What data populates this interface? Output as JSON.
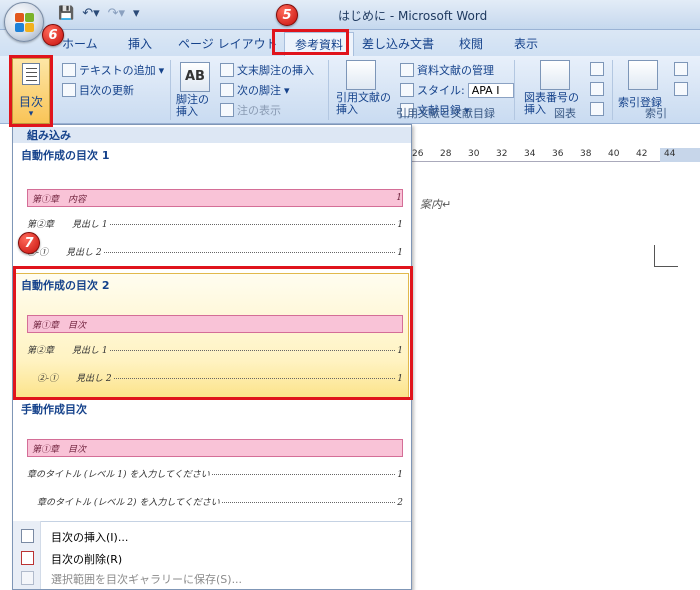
{
  "window": {
    "title": "はじめに - Microsoft Word"
  },
  "quick_access": {
    "save_icon": "save-icon",
    "undo_icon": "undo-icon",
    "redo_icon": "redo-icon"
  },
  "tabs": [
    {
      "label": "ホーム",
      "selected": false
    },
    {
      "label": "挿入",
      "selected": false
    },
    {
      "label": "ページ レイアウト",
      "selected": false
    },
    {
      "label": "参考資料",
      "selected": true
    },
    {
      "label": "差し込み文書",
      "selected": false
    },
    {
      "label": "校閲",
      "selected": false
    },
    {
      "label": "表示",
      "selected": false
    }
  ],
  "ribbon": {
    "toc_group": {
      "toc_button": "目次",
      "add_text": "テキストの追加",
      "update_toc": "目次の更新"
    },
    "footnote_group": {
      "insert_footnote": "脚注の\n挿入",
      "insert_endnote": "文末脚注の挿入",
      "next_footnote": "次の脚注",
      "show_notes": "注の表示"
    },
    "citation_group": {
      "insert_citation": "引用文献の\n挿入",
      "manage_sources": "資料文献の管理",
      "style_label": "スタイル:",
      "style_value": "APA I",
      "bibliography": "文献目録",
      "group_label": "引用文献と文献目録"
    },
    "caption_group": {
      "insert_caption": "図表番号の\n挿入",
      "group_label": "図表"
    },
    "index_group": {
      "mark_entry": "索引登録",
      "group_label": "索引"
    }
  },
  "ruler": {
    "ticks": [
      "26",
      "28",
      "30",
      "32",
      "34",
      "36",
      "38",
      "40",
      "42",
      "44"
    ]
  },
  "document": {
    "visible_text": "案内↵"
  },
  "toc_gallery": {
    "header": "組み込み",
    "entries": [
      {
        "title": "自動作成の目次 1",
        "lines": [
          {
            "text": "第①章　内容",
            "page": "1",
            "highlight": true
          },
          {
            "text": "第②章　　見出し 1",
            "page": "1"
          },
          {
            "text": "②-①　　見出し 2",
            "page": "1"
          }
        ]
      },
      {
        "title": "自動作成の目次 2",
        "lines": [
          {
            "text": "第①章　目次",
            "page": "",
            "highlight": true
          },
          {
            "text": "第②章　　見出し 1",
            "page": "1"
          },
          {
            "text": "②-①　　見出し 2",
            "page": "1"
          }
        ]
      },
      {
        "title": "手動作成目次",
        "lines": [
          {
            "text": "第①章　目次",
            "page": "",
            "highlight": true
          },
          {
            "text": "章のタイトル (レベル 1) を入力してください",
            "page": "1"
          },
          {
            "text": "章のタイトル (レベル 2) を入力してください",
            "page": "2"
          }
        ]
      }
    ],
    "menu": [
      {
        "label": "目次の挿入(I)...",
        "disabled": false
      },
      {
        "label": "目次の削除(R)",
        "disabled": false
      },
      {
        "label": "選択範囲を目次ギャラリーに保存(S)...",
        "disabled": true
      }
    ]
  },
  "callouts": {
    "five": "5",
    "six": "6",
    "seven": "7"
  },
  "colors": {
    "highlight_red": "#e0141c",
    "toc_pink": "#f9c3d7",
    "ribbon_blue": "#d5e3f4"
  }
}
